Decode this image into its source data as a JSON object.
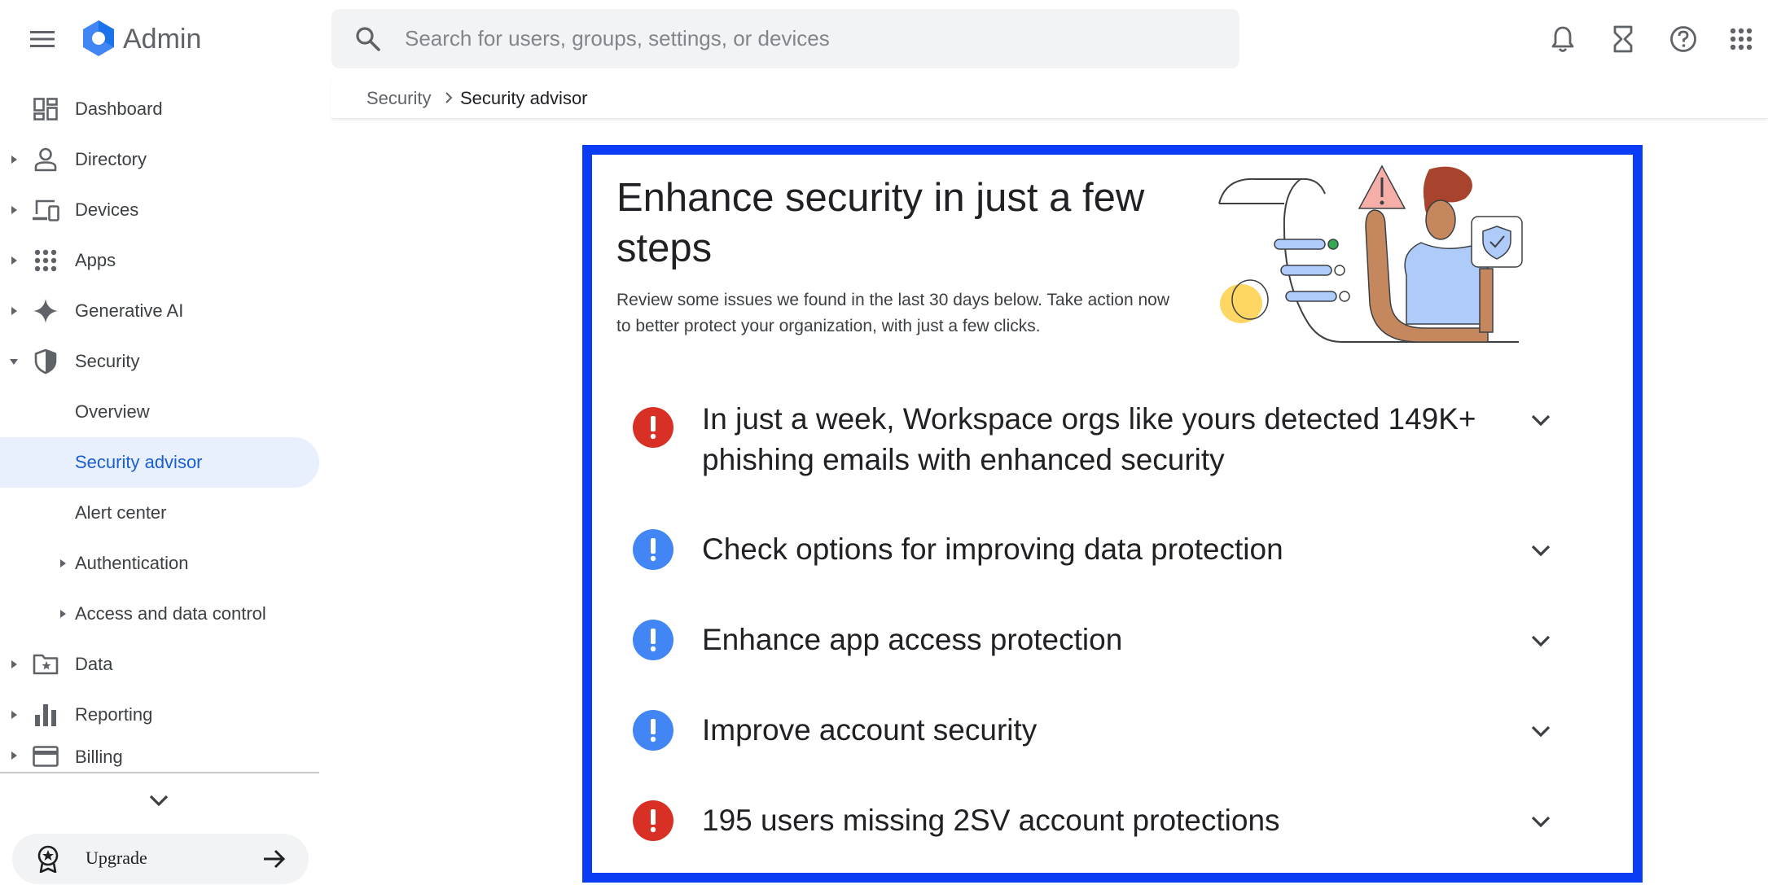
{
  "app": {
    "title": "Admin"
  },
  "search": {
    "placeholder": "Search for users, groups, settings, or devices"
  },
  "sidebar": {
    "items": [
      {
        "label": "Dashboard"
      },
      {
        "label": "Directory"
      },
      {
        "label": "Devices"
      },
      {
        "label": "Apps"
      },
      {
        "label": "Generative AI"
      },
      {
        "label": "Security"
      },
      {
        "label": "Overview"
      },
      {
        "label": "Security advisor"
      },
      {
        "label": "Alert center"
      },
      {
        "label": "Authentication"
      },
      {
        "label": "Access and data control"
      },
      {
        "label": "Data"
      },
      {
        "label": "Reporting"
      },
      {
        "label": "Billing"
      }
    ],
    "upgrade_label": "Upgrade"
  },
  "breadcrumb": {
    "parent": "Security",
    "current": "Security advisor"
  },
  "card": {
    "title": "Enhance security in just a few steps",
    "subtitle": "Review some issues we found in the last 30 days below. Take action now to better protect your organization, with just a few clicks.",
    "issues": [
      {
        "text": "In just a week, Workspace orgs like yours detected 149K+ phishing emails with enhanced security",
        "severity": "critical"
      },
      {
        "text": "Check options for improving data protection",
        "severity": "info"
      },
      {
        "text": "Enhance app access protection",
        "severity": "info"
      },
      {
        "text": "Improve account security",
        "severity": "info"
      },
      {
        "text": "195 users missing 2SV account protections",
        "severity": "critical"
      }
    ]
  },
  "colors": {
    "accent": "#1a5fd0",
    "active_bg": "#e8f0fe",
    "critical": "#d93025",
    "info": "#4285f4",
    "highlight_frame": "#0a3cf5"
  },
  "icons": [
    "menu-icon",
    "admin-logo-icon",
    "search-icon",
    "bell-icon",
    "hourglass-icon",
    "help-icon",
    "apps-grid-icon",
    "dashboard-icon",
    "person-icon",
    "devices-icon",
    "apps-dots-icon",
    "sparkle-icon",
    "shield-icon",
    "folder-star-icon",
    "bar-chart-icon",
    "credit-card-icon",
    "chevron-down-icon",
    "award-icon",
    "arrow-right-icon",
    "exclamation-icon"
  ]
}
